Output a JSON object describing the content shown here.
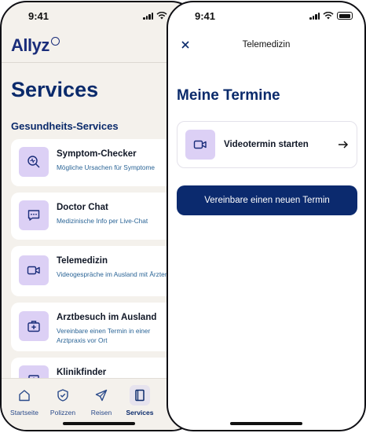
{
  "status_bar": {
    "time": "9:41"
  },
  "services_screen": {
    "logo": "Allyz",
    "title": "Services",
    "section_title": "Gesundheits-Services",
    "services": [
      {
        "title": "Symptom-Checker",
        "description": "Mögliche Ursachen für Symptome",
        "icon": "symptom-search-icon"
      },
      {
        "title": "Doctor Chat",
        "description": "Medizinische Info per Live-Chat",
        "icon": "chat-icon"
      },
      {
        "title": "Telemedizin",
        "description": "Videogespräche im Ausland mit Ärzten",
        "icon": "video-camera-icon"
      },
      {
        "title": "Arztbesuch im Ausland",
        "description": "Vereinbare einen Termin in einer Arztpraxis vor Ort",
        "icon": "medical-bag-icon"
      },
      {
        "title": "Klinikfinder",
        "description": "",
        "icon": "hospital-icon"
      }
    ],
    "tab_bar": [
      {
        "label": "Startseite",
        "icon": "home-icon",
        "active": false
      },
      {
        "label": "Polizzen",
        "icon": "shield-check-icon",
        "active": false
      },
      {
        "label": "Reisen",
        "icon": "airplane-icon",
        "active": false
      },
      {
        "label": "Services",
        "icon": "book-icon",
        "active": true
      }
    ]
  },
  "telemedizin_screen": {
    "nav_title": "Telemedizin",
    "close_icon": "close-icon",
    "title": "Meine Termine",
    "appointment": {
      "label": "Videotermin starten",
      "icon": "video-camera-icon",
      "action_icon": "arrow-right-icon"
    },
    "primary_button": "Vereinbare einen neuen Termin"
  },
  "colors": {
    "brand_navy": "#0b2a6e",
    "icon_tile_lavender": "#dcd0f5",
    "screen_background": "#f4f1ec",
    "description_blue": "#2a6496"
  }
}
